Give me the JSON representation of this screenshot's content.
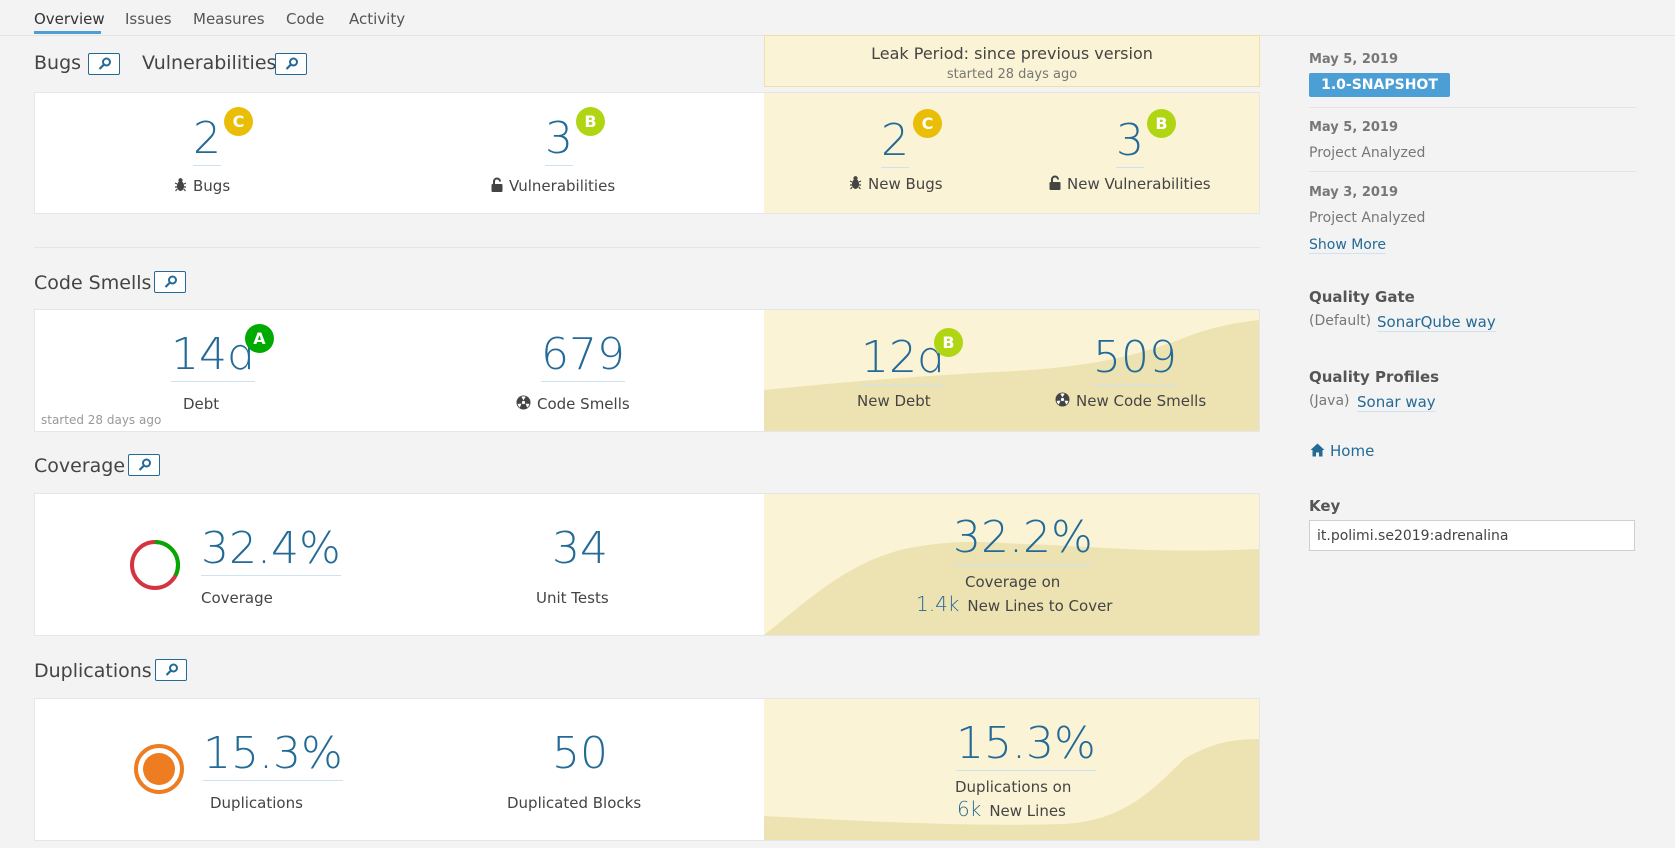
{
  "tabs": [
    "Overview",
    "Issues",
    "Measures",
    "Code",
    "Activity"
  ],
  "colors": {
    "accent": "#236a97",
    "rating_a": "#00aa00",
    "rating_b": "#b0d513",
    "rating_c": "#eabe06",
    "leak_bg": "#fbf3d5",
    "coverage_good": "#00aa00",
    "coverage_bad": "#d4333f",
    "duplications": "#ed7d20",
    "version_badge": "#4b9fd5"
  },
  "leak": {
    "title": "Leak Period: since previous version",
    "started": "started 28 days ago"
  },
  "reliability": {
    "bugs_title": "Bugs",
    "vuln_title": "Vulnerabilities",
    "bugs_value": "2",
    "bugs_rating": "C",
    "bugs_label": "Bugs",
    "vuln_value": "3",
    "vuln_rating": "B",
    "vuln_label": "Vulnerabilities",
    "new_bugs_value": "2",
    "new_bugs_rating": "C",
    "new_bugs_label": "New Bugs",
    "new_vuln_value": "3",
    "new_vuln_rating": "B",
    "new_vuln_label": "New Vulnerabilities"
  },
  "code_smells": {
    "title": "Code Smells",
    "debt_value": "14d",
    "debt_rating": "A",
    "debt_label": "Debt",
    "debt_started": "started 28 days ago",
    "smells_value": "679",
    "smells_label": "Code Smells",
    "new_debt_value": "12d",
    "new_debt_rating": "B",
    "new_debt_label": "New Debt",
    "new_smells_value": "509",
    "new_smells_label": "New Code Smells"
  },
  "coverage": {
    "title": "Coverage",
    "value": "32.4%",
    "label": "Coverage",
    "percent": 32.4,
    "tests_value": "34",
    "tests_label": "Unit Tests",
    "new_value": "32.2%",
    "new_label": "Coverage on",
    "new_lines_value": "1.4k",
    "new_lines_label": "New Lines to Cover"
  },
  "duplications": {
    "title": "Duplications",
    "value": "15.3%",
    "label": "Duplications",
    "blocks_value": "50",
    "blocks_label": "Duplicated Blocks",
    "new_value": "15.3%",
    "new_label": "Duplications on",
    "new_lines_value": "6k",
    "new_lines_label": "New Lines"
  },
  "sidebar": {
    "events": [
      {
        "date": "May 5, 2019",
        "badge": "1.0-SNAPSHOT"
      },
      {
        "date": "May 5, 2019",
        "text": "Project Analyzed"
      },
      {
        "date": "May 3, 2019",
        "text": "Project Analyzed"
      }
    ],
    "show_more": "Show More",
    "quality_gate_title": "Quality Gate",
    "quality_gate_prefix": "(Default)",
    "quality_gate_link": "SonarQube way",
    "quality_profiles_title": "Quality Profiles",
    "quality_profiles_prefix": "(Java)",
    "quality_profiles_link": "Sonar way",
    "home_link": "Home",
    "key_title": "Key",
    "key_value": "it.polimi.se2019:adrenalina"
  },
  "icons": [
    "link-icon",
    "bug-icon",
    "lock-icon",
    "code-smell-icon",
    "home-icon"
  ]
}
